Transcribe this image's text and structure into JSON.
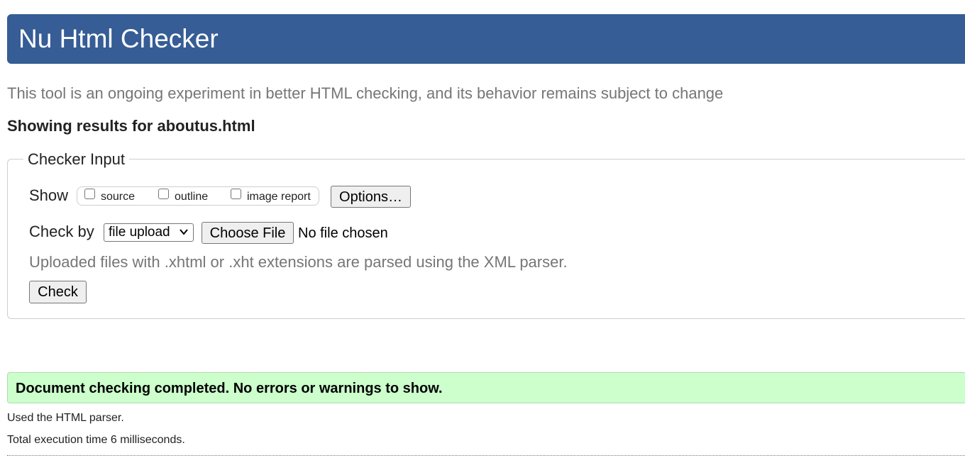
{
  "header": {
    "title": "Nu Html Checker"
  },
  "intro_text": "This tool is an ongoing experiment in better HTML checking, and its behavior remains subject to change",
  "results_heading": "Showing results for aboutus.html",
  "checker_input": {
    "legend": "Checker Input",
    "show_label": "Show",
    "show_options": [
      {
        "label": "source",
        "checked": false
      },
      {
        "label": "outline",
        "checked": false
      },
      {
        "label": "image report",
        "checked": false
      }
    ],
    "options_button": "Options…",
    "check_by_label": "Check by",
    "check_by_selected": "file upload",
    "choose_file_button": "Choose File",
    "no_file_text": "No file chosen",
    "hint": "Uploaded files with .xhtml or .xht extensions are parsed using the XML parser.",
    "check_button": "Check"
  },
  "result": {
    "message": "Document checking completed. No errors or warnings to show.",
    "parser_info": "Used the HTML parser.",
    "timing_info": "Total execution time 6 milliseconds."
  },
  "colors": {
    "banner": "#365d95",
    "success_bg": "#ccffcc",
    "muted_text": "#767676"
  }
}
